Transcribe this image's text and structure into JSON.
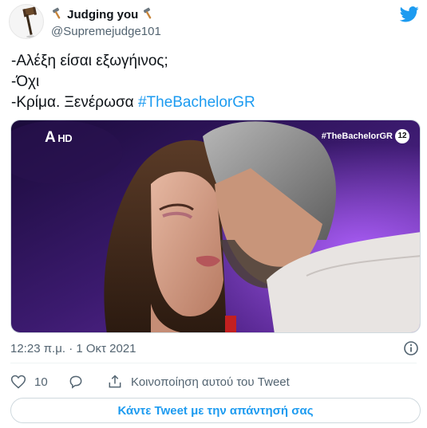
{
  "author": {
    "display_name": "Judging you",
    "handle": "@Supremejudge101",
    "avatar_icon": "gavel-icon",
    "name_emoji": "hammer-icon"
  },
  "tweet": {
    "lines": [
      "-Αλέξη είσαι εξωγήινος;",
      "-Όχι",
      "-Κρίμα. Ξενέρωσα"
    ],
    "hashtag": "#TheBachelorGR"
  },
  "media": {
    "channel_logo": "A",
    "channel_suffix": "HD",
    "show_tag": "#TheBachelorGR",
    "age_rating": "12"
  },
  "meta": {
    "timestamp": "12:23 π.μ. · 1 Οκτ 2021"
  },
  "actions": {
    "like_count": "10",
    "share_label": "Κοινοποίηση αυτού του Tweet"
  },
  "reply_button": {
    "label": "Κάντε Tweet με την απάντησή σας"
  },
  "colors": {
    "accent": "#1d9bf0",
    "secondary_text": "#536471",
    "primary_text": "#0f1419"
  }
}
